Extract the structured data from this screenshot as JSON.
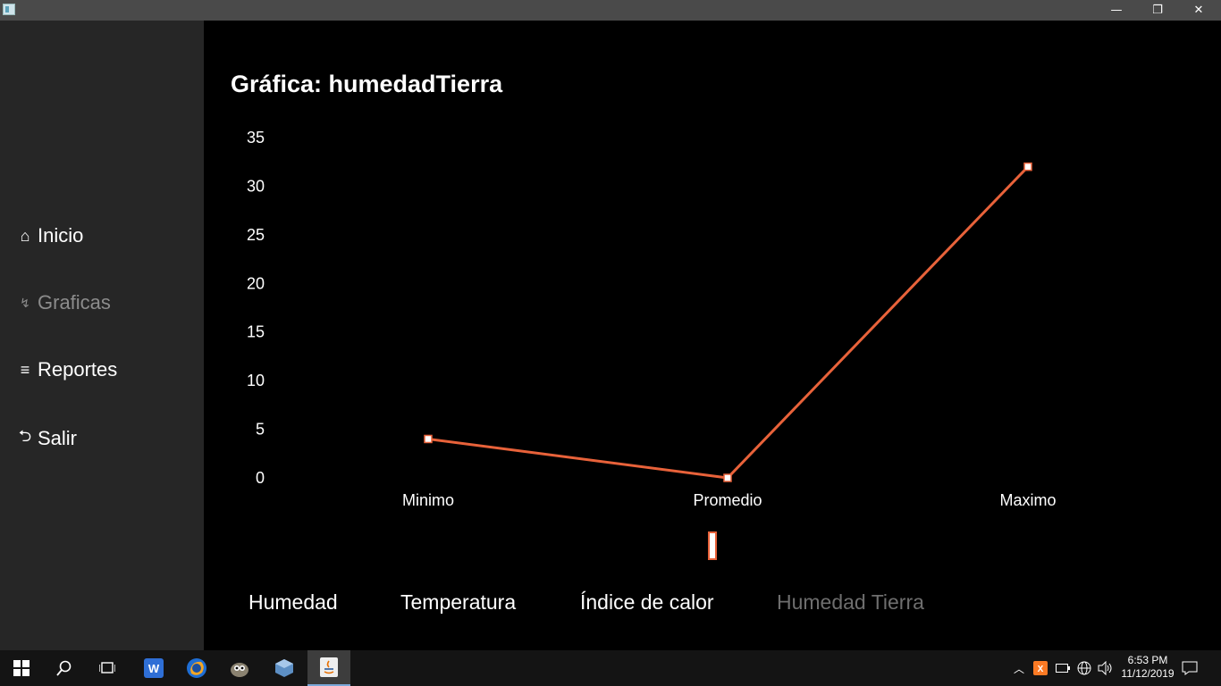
{
  "window": {
    "minimize_glyph": "—",
    "restore_glyph": "❐",
    "close_glyph": "✕"
  },
  "sidebar": {
    "items": [
      {
        "icon": "⌂",
        "label": "Inicio",
        "icon_name": "home-icon"
      },
      {
        "icon": "↯",
        "label": "Graficas",
        "icon_name": "chart-icon"
      },
      {
        "icon": "≡",
        "label": "Reportes",
        "icon_name": "reports-icon"
      },
      {
        "icon": "⮌",
        "label": "Salir",
        "icon_name": "exit-icon"
      }
    ]
  },
  "main": {
    "title": "Gráfica: humedadTierra",
    "tabs": [
      "Humedad",
      "Temperatura",
      "Índice de calor",
      "Humedad Tierra"
    ]
  },
  "chart_data": {
    "type": "line",
    "title": "Gráfica: humedadTierra",
    "categories": [
      "Minimo",
      "Promedio",
      "Maximo"
    ],
    "series": [
      {
        "values": [
          4,
          0,
          32
        ]
      }
    ],
    "ylim": [
      0,
      35
    ],
    "yticks": [
      0,
      5,
      10,
      15,
      20,
      25,
      30,
      35
    ],
    "xlabel": "",
    "ylabel": "",
    "grid": false,
    "line_color": "#e8623a",
    "marker_fill": "#ffffff"
  },
  "taskbar": {
    "clock_time": "6:53 PM",
    "clock_date": "11/12/2019"
  },
  "colors": {
    "sidebar_bg": "#262626",
    "main_bg": "#000000",
    "accent": "#e8623a"
  }
}
